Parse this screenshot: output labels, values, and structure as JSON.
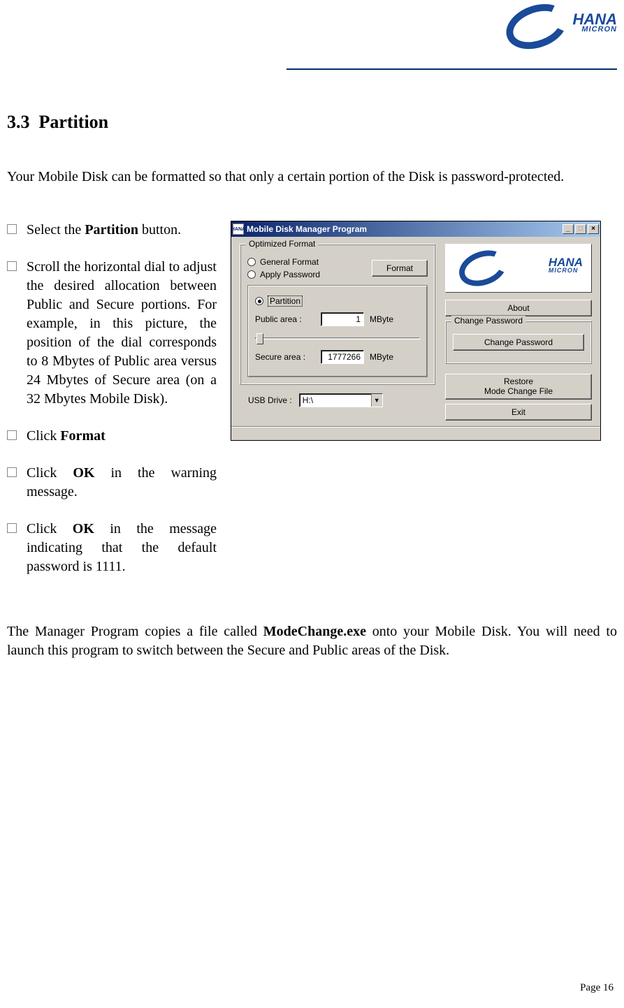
{
  "logo": {
    "brand": "HANA",
    "sub": "MICRON"
  },
  "section": {
    "num": "3.3",
    "title": "Partition"
  },
  "intro": "Your Mobile Disk can be formatted so that only a certain portion of the Disk is password-protected.",
  "steps": {
    "s1a": "Select the ",
    "s1b": "Partition",
    "s1c": " button.",
    "s2": "Scroll the horizontal dial to adjust the desired allocation between Public and Secure portions.  For example, in this picture, the position of the dial corresponds to 8 Mbytes of Public area versus 24 Mbytes of Secure area (on a 32 Mbytes Mobile Disk).",
    "s3a": "Click ",
    "s3b": "Format",
    "s4a": "Click ",
    "s4b": "OK",
    "s4c": " in the warning message.",
    "s5a": "Click ",
    "s5b": "OK",
    "s5c": " in the message indicating that the default password is 1111."
  },
  "outro_a": "The Manager Program copies a file called ",
  "outro_b": "ModeChange.exe",
  "outro_c": " onto your Mobile Disk.  You will need to launch this program to switch between the Secure and Public areas of the Disk.",
  "page_footer": "Page 16",
  "app": {
    "title": "Mobile Disk Manager Program",
    "group_optimized": "Optimized Format",
    "radio_general": "General Format",
    "radio_apply": "Apply Password",
    "btn_format": "Format",
    "radio_partition": "Partition",
    "lbl_public": "Public area :",
    "val_public": "1",
    "unit": "MByte",
    "lbl_secure": "Secure area :",
    "val_secure": "1777266",
    "lbl_usb": "USB Drive :",
    "val_usb": "H:\\",
    "btn_about": "About",
    "group_change": "Change Password",
    "btn_change": "Change Password",
    "btn_restore_l1": "Restore",
    "btn_restore_l2": "Mode Change File",
    "btn_exit": "Exit",
    "win_min": "_",
    "win_max": "□",
    "win_close": "×"
  }
}
